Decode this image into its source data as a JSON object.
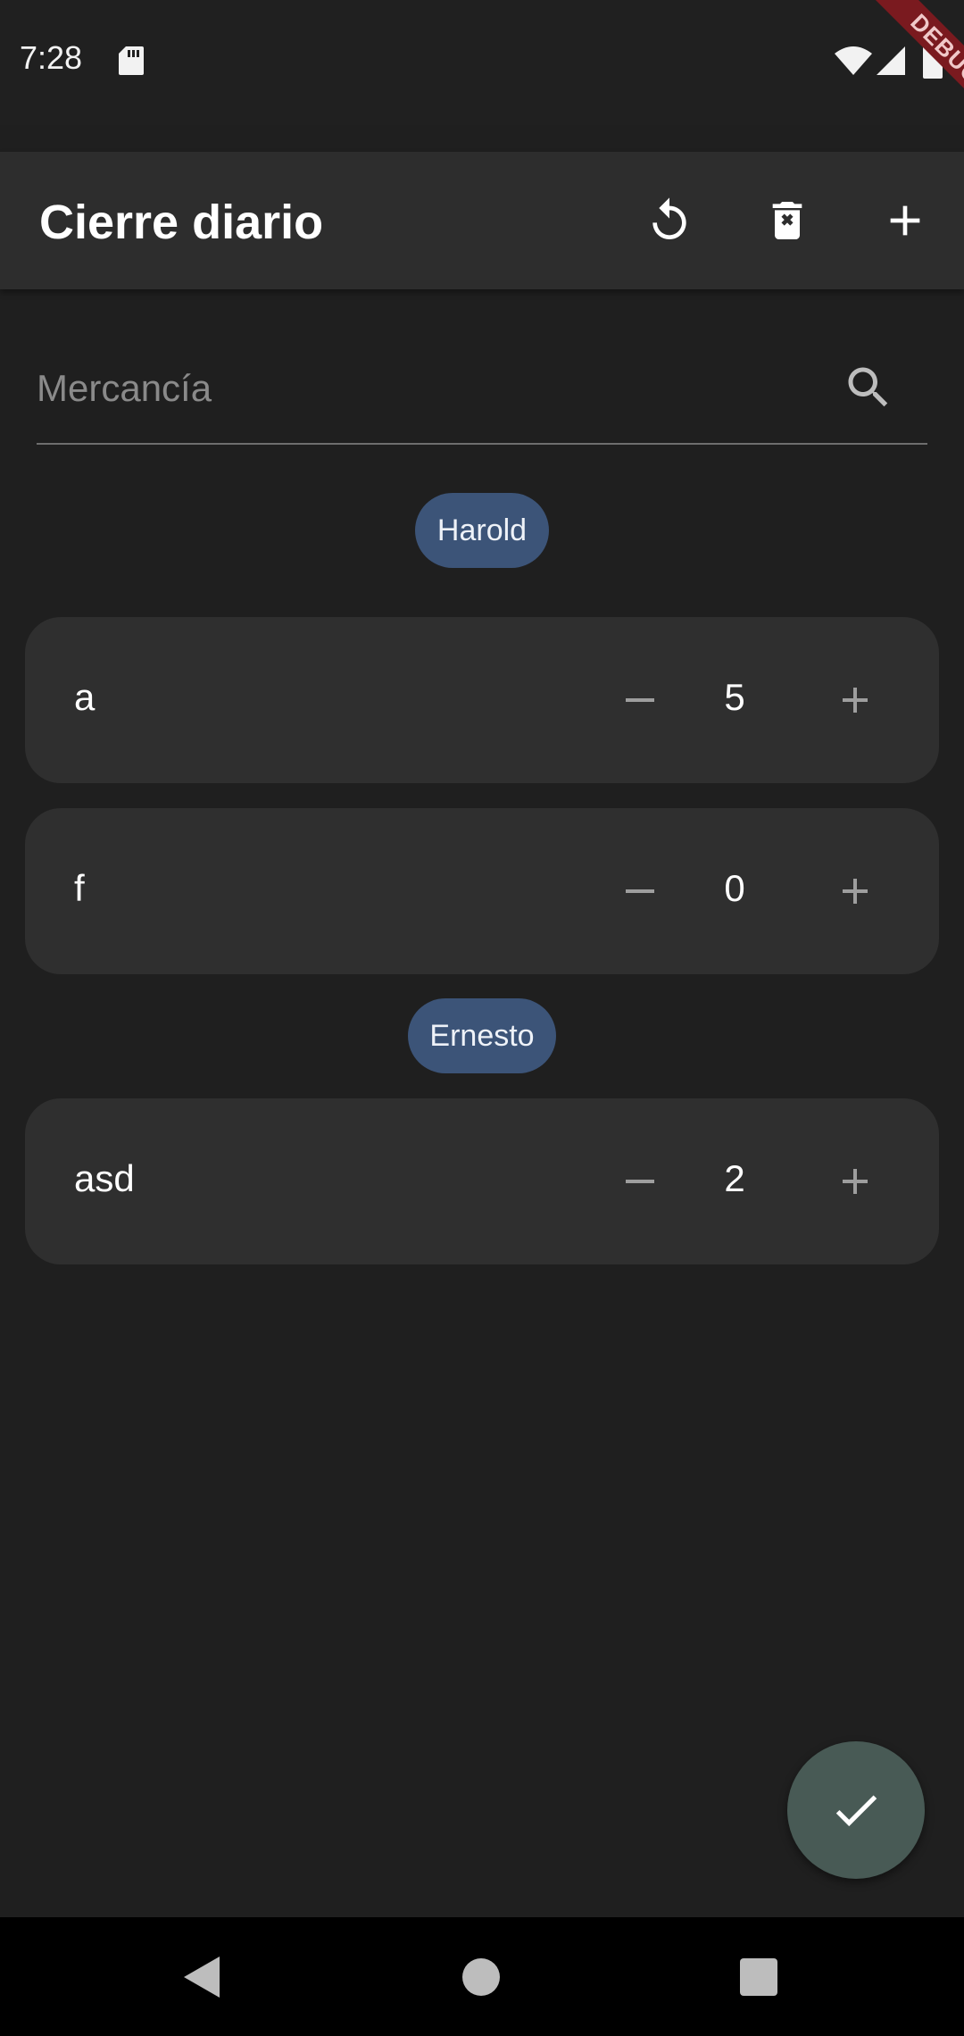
{
  "status_bar": {
    "time": "7:28",
    "debug_label": "DEBUG",
    "icons": [
      "sd-card-icon",
      "wifi-icon",
      "signal-icon",
      "battery-icon"
    ]
  },
  "app_bar": {
    "title": "Cierre diario",
    "actions": [
      "refresh-icon",
      "delete-icon",
      "add-icon"
    ]
  },
  "search": {
    "placeholder": "Mercancía",
    "value": ""
  },
  "groups": [
    {
      "name": "Harold",
      "items": [
        {
          "name": "a",
          "count": "5"
        },
        {
          "name": "f",
          "count": "0"
        }
      ]
    },
    {
      "name": "Ernesto",
      "items": [
        {
          "name": "asd",
          "count": "2"
        }
      ]
    }
  ],
  "fab": {
    "icon": "check-icon"
  },
  "nav_bar": {
    "icons": [
      "back-icon",
      "home-icon",
      "recents-icon"
    ]
  },
  "colors": {
    "background": "#1f1f1f",
    "app_bar": "#2d2d2d",
    "card": "#2f2f2f",
    "chip": "#3c5478",
    "fab": "#485a55",
    "debug_ribbon": "#7a1a1f"
  }
}
